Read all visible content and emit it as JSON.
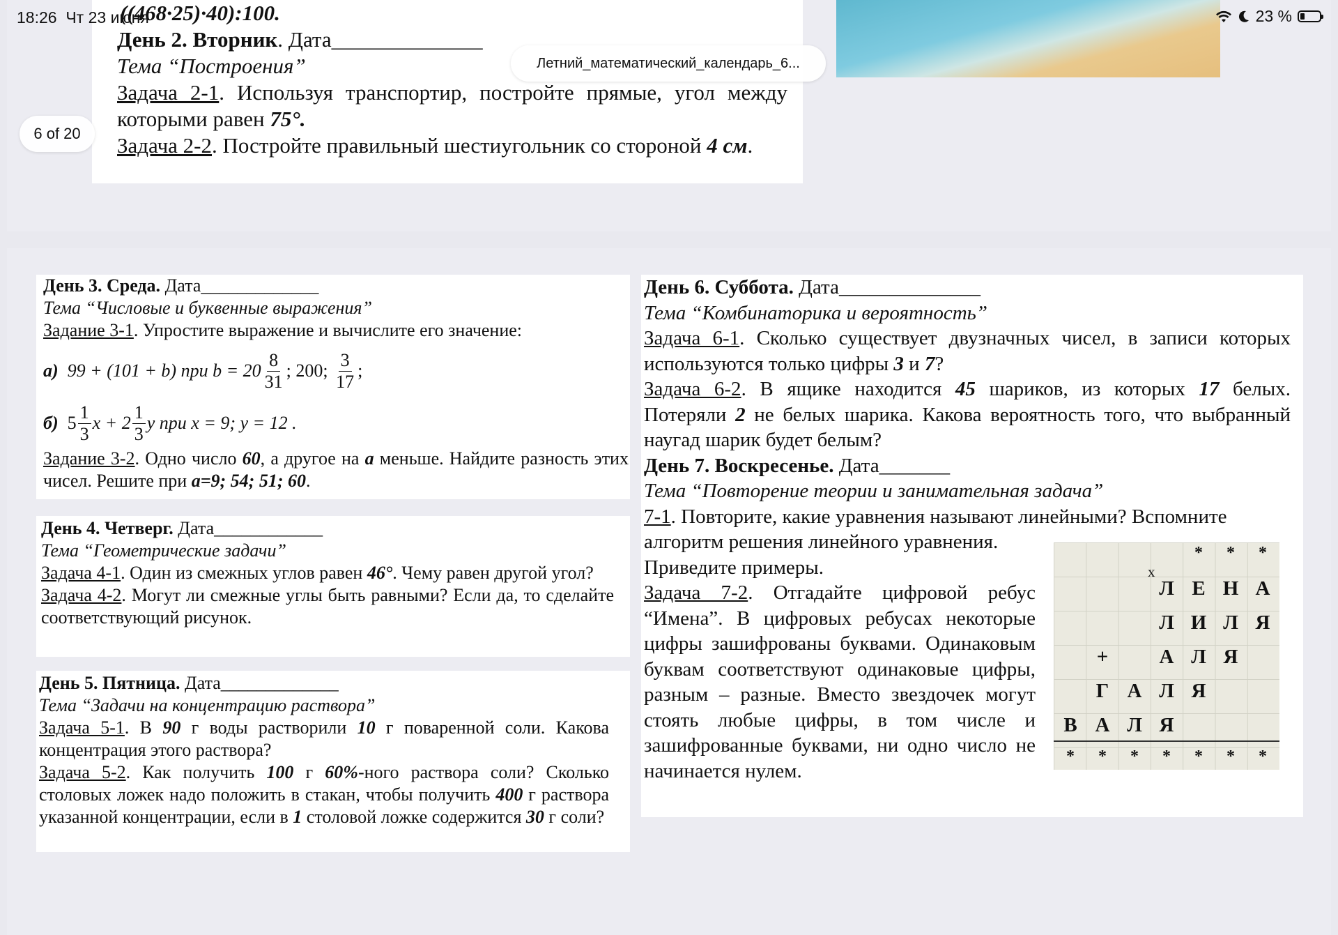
{
  "status_bar": {
    "time": "18:26",
    "date": "Чт 23 июня",
    "battery": "23 %"
  },
  "viewer": {
    "filename": "Летний_математический_календарь_6...",
    "page_counter": "6 of 20"
  },
  "page_top": {
    "line0": "((468·25)·40):100.",
    "day2_head": "День 2. Вторник",
    "day2_date": ". Дата______________",
    "day2_theme": "Тема “Построения”",
    "t21_label": "Задача 2-1",
    "t21_text": ". Используя транспортир, постройте прямые, угол между которыми равен ",
    "t21_val": "75°.",
    "t22_label": "Задача 2-2",
    "t22_text": ". Постройте правильный шестиугольник со стороной ",
    "t22_val": "4 см",
    "t22_end": "."
  },
  "day3": {
    "head": "День 3. Среда.",
    "date": " Дата_____________",
    "theme": "Тема “Числовые и буквенные выражения”",
    "task1_label": "Задание 3-1",
    "task1_text": ". Упростите выражение и вычислите его значение:",
    "a_label": "а)",
    "a_expr": "99 + (101 + b)  при  b = 20",
    "a_f1_n": "8",
    "a_f1_d": "31",
    "a_mid": ";  200;",
    "a_f2_n": "3",
    "a_f2_d": "17",
    "a_end": ";",
    "b_label": "б)",
    "b_p1": "5",
    "b_f1_n": "1",
    "b_f1_d": "3",
    "b_p2": "x + 2",
    "b_f2_n": "1",
    "b_f2_d": "3",
    "b_p3": "y  при  x = 9;  y = 12 .",
    "task2_label": "Задание 3-2",
    "task2_t1": ". Одно число ",
    "task2_v1": "60",
    "task2_t2": ", а другое на ",
    "task2_v2": "а",
    "task2_t3": " меньше. Найдите разность этих чисел. Решите при ",
    "task2_v3": "а=9; 54; 51; 60",
    "task2_end": "."
  },
  "day4": {
    "head": "День 4. Четверг.",
    "date": " Дата____________",
    "theme": "Тема “Геометрические задачи”",
    "t1_label": "Задача 4-1",
    "t1_a": ". Один из смежных углов равен ",
    "t1_v": "46°",
    "t1_b": ". Чему равен другой угол?",
    "t2_label": "Задача 4-2",
    "t2_text": ". Могут ли смежные углы быть равными? Если да, то сделайте соответствующий рисунок."
  },
  "day5": {
    "head": "День 5. Пятница.",
    "date": " Дата_____________",
    "theme": "Тема “Задачи на концентрацию раствора”",
    "t1_label": "Задача 5-1",
    "t1_a": ". В ",
    "t1_v1": "90",
    "t1_b": " г воды растворили ",
    "t1_v2": "10",
    "t1_c": " г поваренной соли. Какова концентрация этого раствора?",
    "t2_label": "Задача 5-2",
    "t2_a": ". Как получить ",
    "t2_v1": "100",
    "t2_b": " г ",
    "t2_v2": "60%",
    "t2_c": "-ного раствора соли? Сколько столовых ложек надо положить в стакан, чтобы получить ",
    "t2_v3": "400",
    "t2_d": " г раствора указанной концентрации, если в ",
    "t2_v4": "1",
    "t2_e": " столовой ложке содержится ",
    "t2_v5": "30",
    "t2_f": " г соли?"
  },
  "day6": {
    "head": "День 6. Суббота.",
    "date": " Дата______________",
    "theme": "Тема “Комбинаторика и вероятность”",
    "t1_label": "Задача 6-1",
    "t1_a": ". Сколько существует двузначных чисел, в записи которых используются только цифры ",
    "t1_v1": "3",
    "t1_b": " и ",
    "t1_v2": "7",
    "t1_c": "?",
    "t2_label": "Задача 6-2",
    "t2_a": ". В ящике находится ",
    "t2_v1": "45",
    "t2_b": " шариков, из которых ",
    "t2_v2": "17",
    "t2_c": " белых. Потеряли ",
    "t2_v3": "2",
    "t2_d": " не белых шарика. Какова вероятность того, что выбранный наугад шарик будет белым?"
  },
  "day7": {
    "head": "День 7. Воскресенье.",
    "date": " Дата_______",
    "theme": "Тема “Повторение теории и занимательная задача”",
    "t1_label": "7-1",
    "t1_text": ". Повторите, какие уравнения называют линейными? Вспомните",
    "t1_text2": "алгоритм решения линейного уравнения.",
    "t1_text3": "Приведите примеры.",
    "t2_label": "Задача 7-2",
    "t2_text": ". Отгадайте цифровой ребус “Имена”. В цифровых ребусах некоторые цифры зашифрованы буквами. Одинаковым буквам соответствуют одинаковые цифры, разным – разные. Вместо звездочек могут стоять любые цифры, в том числе и зашифрованные буквами, ни одно число не начинается нулем."
  },
  "rebus": {
    "star": "*",
    "cross": "x",
    "plus": "+",
    "row1": [
      "Л",
      "Е",
      "Н",
      "А"
    ],
    "row2": [
      "Л",
      "И",
      "Л",
      "Я"
    ],
    "row3": [
      "А",
      "Л",
      "Я"
    ],
    "row4": [
      "Г",
      "А",
      "Л",
      "Я"
    ],
    "row5": [
      "В",
      "А",
      "Л",
      "Я"
    ]
  }
}
